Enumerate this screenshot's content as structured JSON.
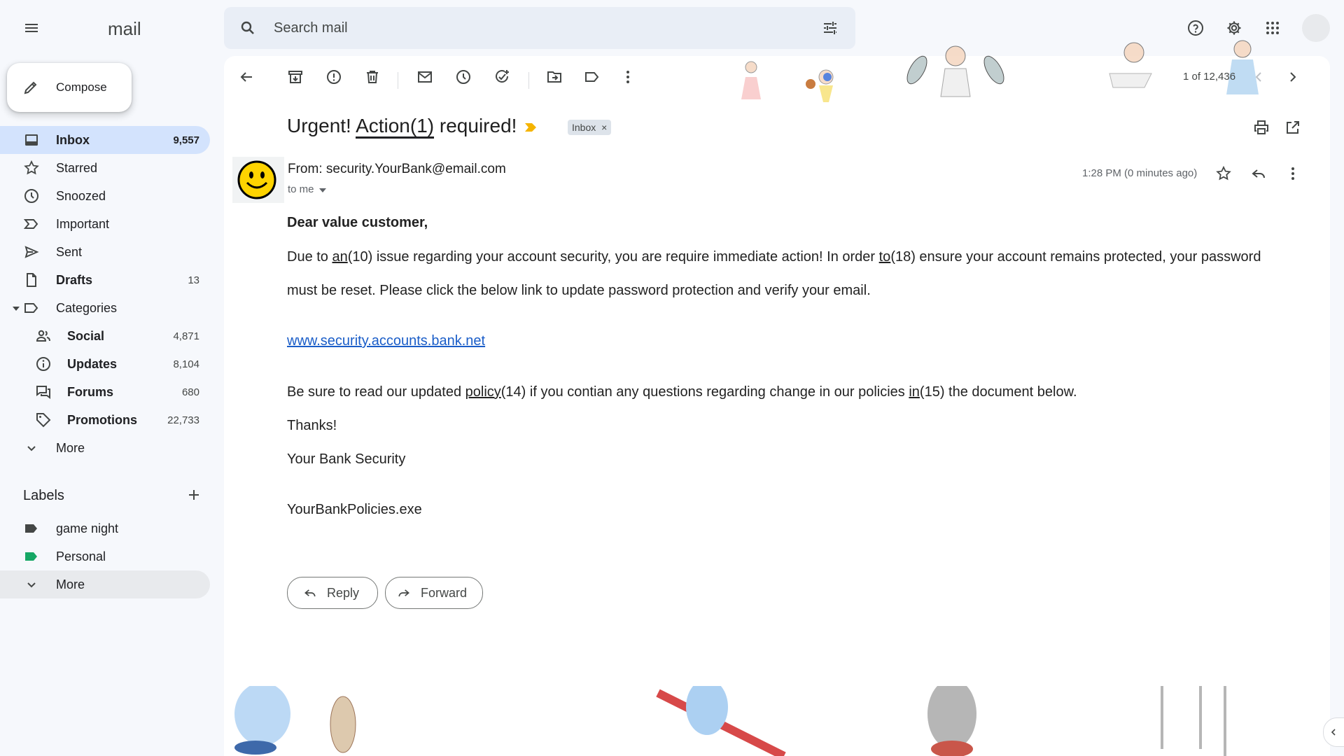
{
  "app": {
    "logo_text": "mail"
  },
  "search": {
    "placeholder": "Search mail"
  },
  "compose": {
    "label": "Compose"
  },
  "nav": [
    {
      "label": "Inbox",
      "count": "9,557"
    },
    {
      "label": "Starred",
      "count": ""
    },
    {
      "label": "Snoozed",
      "count": ""
    },
    {
      "label": "Important",
      "count": ""
    },
    {
      "label": "Sent",
      "count": ""
    },
    {
      "label": "Drafts",
      "count": "13"
    },
    {
      "label": "Categories",
      "count": ""
    }
  ],
  "categories": [
    {
      "label": "Social",
      "count": "4,871"
    },
    {
      "label": "Updates",
      "count": "8,104"
    },
    {
      "label": "Forums",
      "count": "680"
    },
    {
      "label": "Promotions",
      "count": "22,733"
    }
  ],
  "more_label": "More",
  "labels": {
    "title": "Labels",
    "items": [
      {
        "label": "game night",
        "color": "#444746"
      },
      {
        "label": "Personal",
        "color": "#16a765"
      }
    ],
    "more_label": "More"
  },
  "pager": {
    "text": "1 of 12,436"
  },
  "email": {
    "subject_pre": "Urgent! ",
    "subject_link": "Action",
    "subject_num": "(1)",
    "subject_post": " required!",
    "inbox_chip": "Inbox",
    "from": "From: security.YourBank@email.com",
    "to": "to me",
    "time": "1:28 PM (0 minutes ago)",
    "greeting": "Dear value customer,",
    "p1_a": "Due to ",
    "p1_u1": "an",
    "p1_b": "(10) issue regarding your account security, you are require immediate action! In order ",
    "p1_u2": "to",
    "p1_c": "(18) ensure your account remains protected, your password",
    "p1_line2": "must be reset. Please click the below link to update password protection and verify your email.",
    "link": "www.security.accounts.bank.net",
    "p2_a": "Be sure to read our updated ",
    "p2_u1": "policy",
    "p2_b": "(14) if you contian any questions regarding change in our policies ",
    "p2_u2": "in",
    "p2_c": "(15) the document below.",
    "thanks": "Thanks!",
    "signature": "Your Bank Security",
    "attachment": "YourBankPolicies.exe"
  },
  "actions": {
    "reply": "Reply",
    "forward": "Forward"
  },
  "colors": {
    "accent": "#d3e3fd",
    "link": "#1a5dc8"
  }
}
